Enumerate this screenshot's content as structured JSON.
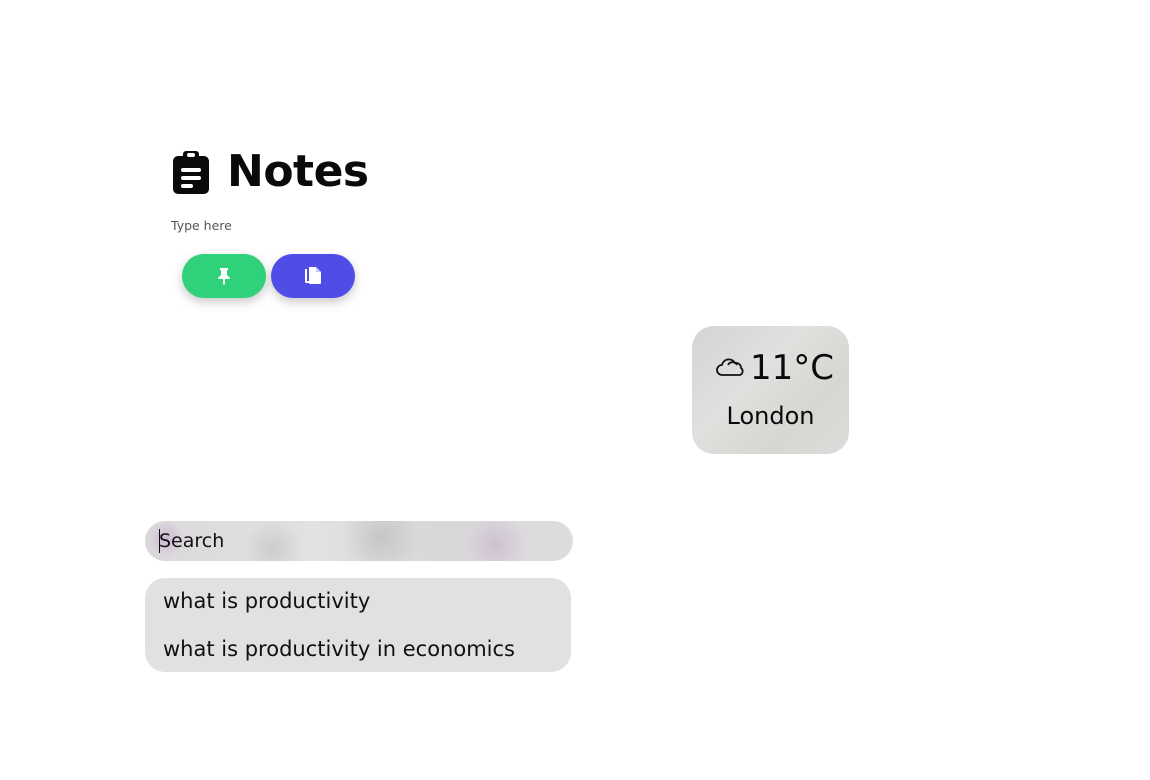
{
  "notes": {
    "title": "Notes",
    "input_placeholder": "Type here",
    "icon": "clipboard-list-icon",
    "buttons": [
      {
        "icon": "pin-icon",
        "color": "#2fd27a"
      },
      {
        "icon": "copy-icon",
        "color": "#4f4de6"
      }
    ]
  },
  "weather": {
    "icon": "cloud-icon",
    "temperature": "11°C",
    "city": "London"
  },
  "search": {
    "placeholder": "Search",
    "suggestions": [
      "what is productivity",
      "what is productivity in economics"
    ]
  }
}
